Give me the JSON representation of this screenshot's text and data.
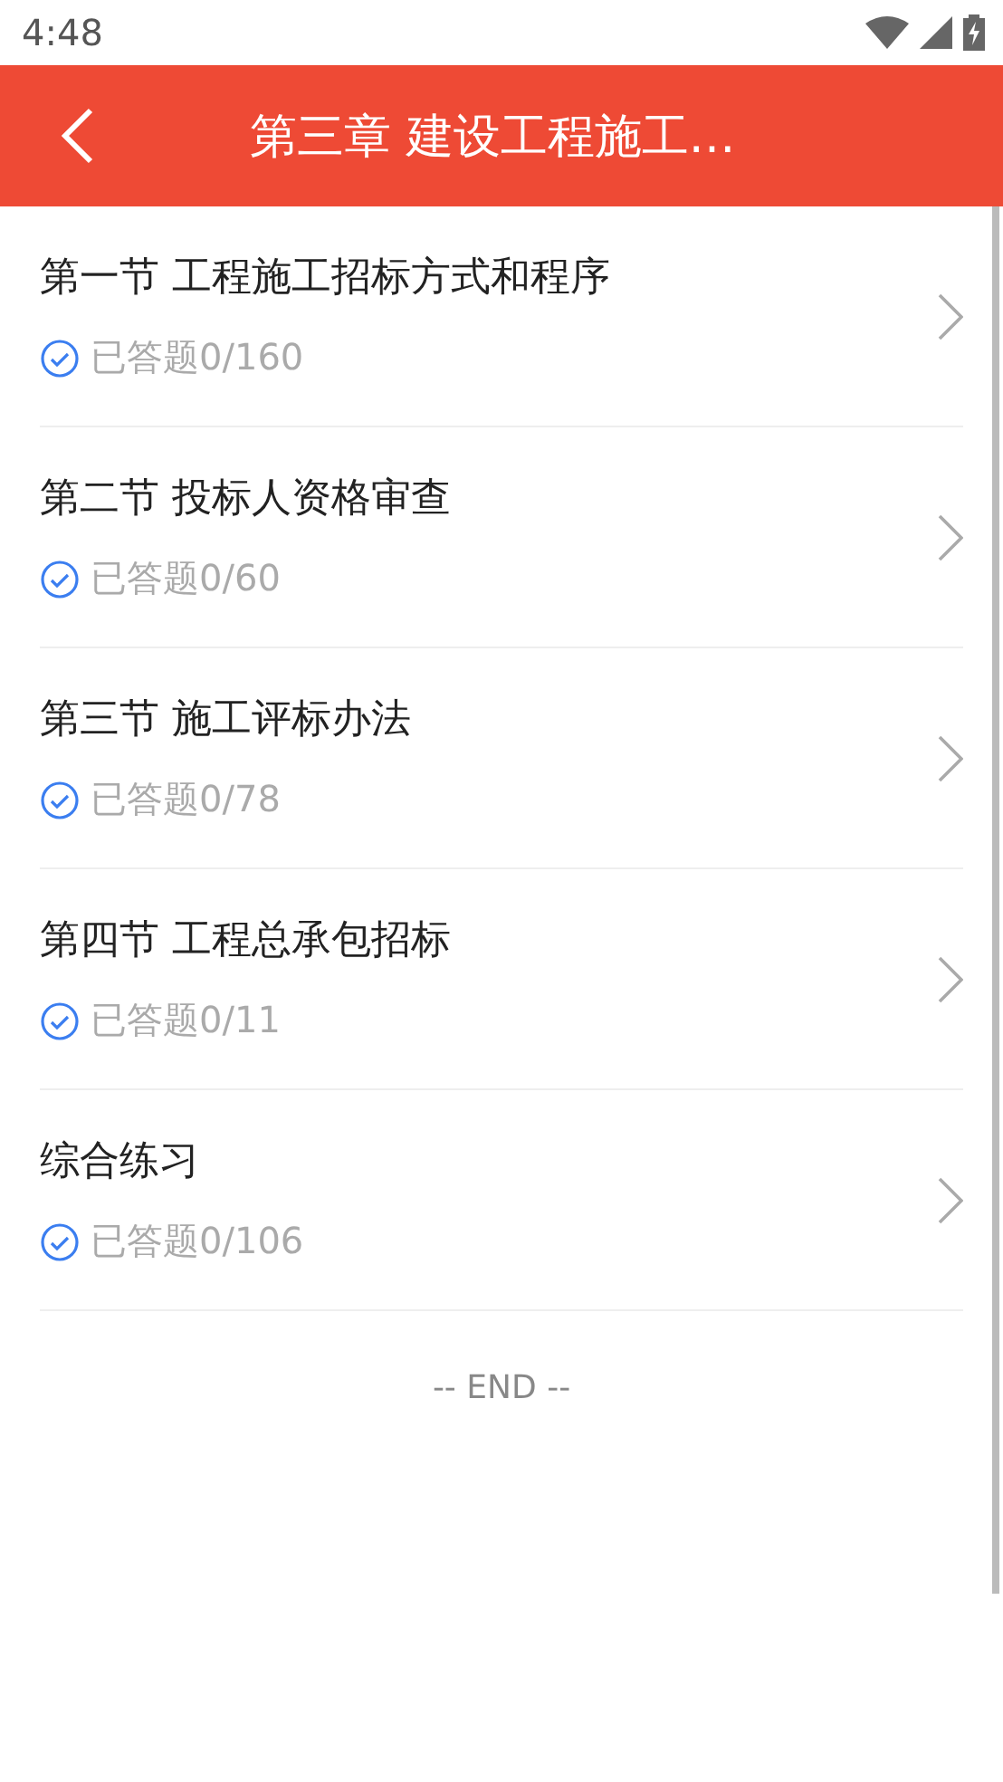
{
  "status_bar": {
    "time": "4:48"
  },
  "header": {
    "title": "第三章 建设工程施工…"
  },
  "sections": [
    {
      "title": "第一节 工程施工招标方式和程序",
      "progress": "已答题0/160"
    },
    {
      "title": "第二节 投标人资格审查",
      "progress": "已答题0/60"
    },
    {
      "title": "第三节 施工评标办法",
      "progress": "已答题0/78"
    },
    {
      "title": "第四节 工程总承包招标",
      "progress": "已答题0/11"
    },
    {
      "title": "综合练习",
      "progress": "已答题0/106"
    }
  ],
  "end_text": "-- END --"
}
